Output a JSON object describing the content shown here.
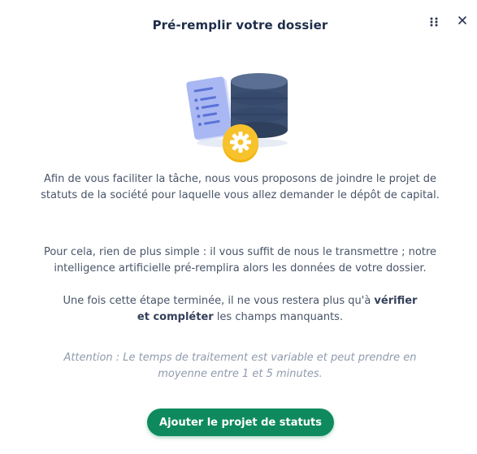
{
  "modal": {
    "title": "Pré-remplir votre dossier",
    "drag_handle_icon": "grip-dots-icon",
    "close_icon": "close-icon",
    "illustration": "document-database-gear-illustration"
  },
  "body": {
    "p1": "Afin de vous faciliter la tâche, nous vous proposons de joindre le projet de statuts de la société pour laquelle vous allez demander le dépôt de capital.",
    "p2": "Pour cela, rien de plus simple : il vous suffit de nous le transmettre ; notre intelligence artificielle pré-remplira alors les données de votre dossier.",
    "p3": {
      "before": "Une fois cette étape terminée, il ne vous restera plus qu'à ",
      "bold1": "vérifier et compléter",
      "after": " les champs manquants."
    },
    "note": "Attention : Le temps de traitement est variable et peut prendre en moyenne entre 1 et 5 minutes."
  },
  "actions": {
    "primary_label": "Ajouter le projet de statuts"
  },
  "colors": {
    "primary": "#0e8a5e",
    "title": "#1f2d4a",
    "text": "#485468",
    "note": "#8f9bad",
    "database": "#3b4f70",
    "document": "#a9b8f2",
    "gear_badge": "#f2b30c"
  }
}
